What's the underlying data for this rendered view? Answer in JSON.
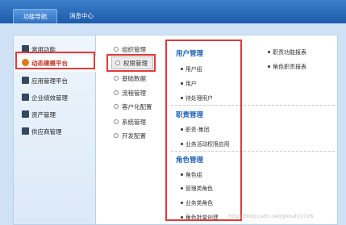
{
  "tabs": [
    {
      "label": "功能导航"
    },
    {
      "label": "消息中心"
    }
  ],
  "sidebar": {
    "items": [
      {
        "label": "常用功能",
        "icon": "monitor-icon"
      },
      {
        "label": "动态建模平台",
        "icon": "cube-icon"
      },
      {
        "label": "应用管理平台",
        "icon": "app-icon"
      },
      {
        "label": "企业绩效管理",
        "icon": "chart-icon"
      },
      {
        "label": "资产管理",
        "icon": "asset-icon"
      },
      {
        "label": "供应商管理",
        "icon": "supplier-icon"
      }
    ]
  },
  "modules": [
    {
      "label": "组织管理"
    },
    {
      "label": "权限管理"
    },
    {
      "label": "基础数据"
    },
    {
      "label": "流程管理"
    },
    {
      "label": "客户化配置"
    },
    {
      "label": "系统管理"
    },
    {
      "label": "开发配置"
    }
  ],
  "permissions": {
    "groups": [
      {
        "title": "用户管理",
        "items": [
          "用户组",
          "用户",
          "待处理用户"
        ]
      },
      {
        "title": "职责管理",
        "items": [
          "职责-集团",
          "业务活动权限启用"
        ]
      },
      {
        "title": "角色管理",
        "items": [
          "角色组",
          "管理类角色",
          "业务类角色",
          "角色批量创建"
        ]
      }
    ]
  },
  "reports": [
    "职责功能报表",
    "角色职责报表"
  ],
  "watermark": "http://blog.csdn.net/gnouh/1726",
  "colors": {
    "accent": "#1a5fb4",
    "highlight": "#e03a3a",
    "active_sidebar": "#c0392b"
  }
}
